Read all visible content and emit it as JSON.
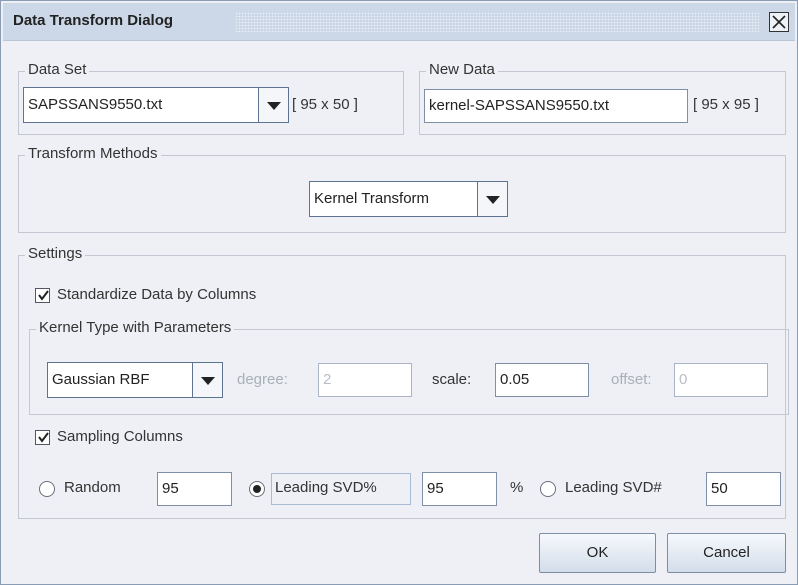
{
  "window": {
    "title": "Data Transform Dialog"
  },
  "data_set": {
    "legend": "Data Set",
    "selected_file": "SAPSSANS9550.txt",
    "dimensions": "[ 95 x 50 ]"
  },
  "new_data": {
    "legend": "New Data",
    "file_name": "kernel-SAPSSANS9550.txt",
    "dimensions": "[ 95 x 95 ]"
  },
  "transform_methods": {
    "legend": "Transform Methods",
    "selected": "Kernel Transform"
  },
  "settings": {
    "legend": "Settings",
    "standardize_label": "Standardize Data by Columns",
    "standardize_checked": true,
    "kernel": {
      "legend": "Kernel Type with Parameters",
      "type": "Gaussian RBF",
      "degree_label": "degree:",
      "degree_value": "2",
      "scale_label": "scale:",
      "scale_value": "0.05",
      "offset_label": "offset:",
      "offset_value": "0"
    },
    "sampling_label": "Sampling Columns",
    "sampling_checked": true,
    "random_label": "Random",
    "random_value": "95",
    "leading_svd_pct_label": "Leading SVD%",
    "leading_svd_pct_value": "95",
    "percent_sign": "%",
    "leading_svd_num_label": "Leading SVD#",
    "leading_svd_num_value": "50",
    "selected_sampling": "Leading SVD%"
  },
  "buttons": {
    "ok": "OK",
    "cancel": "Cancel"
  }
}
